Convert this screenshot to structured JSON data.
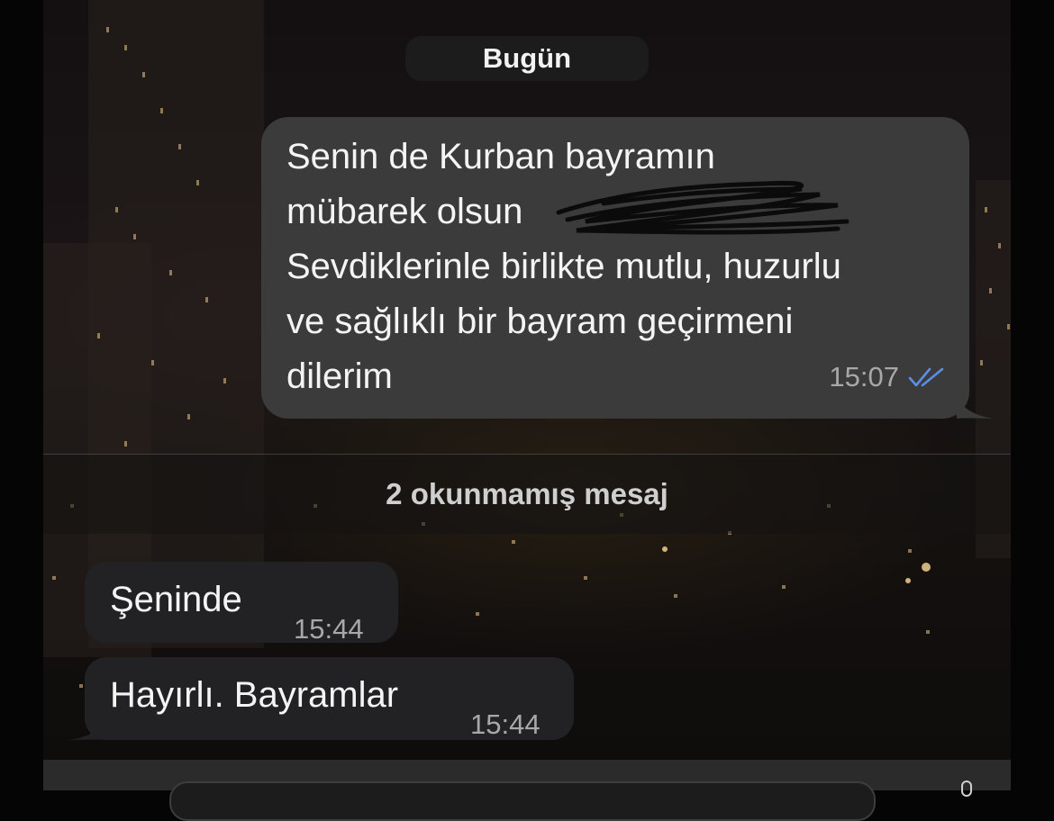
{
  "date_separator": "Bugün",
  "messages": [
    {
      "direction": "outgoing",
      "text": "Senin de Kurban bayramın\nmübarek olsun \nSevdiklerinle birlikte mutlu, huzurlu\nve sağlıklı bir bayram geçirmeni\ndilerim",
      "time": "15:07",
      "status": "read"
    },
    {
      "direction": "incoming",
      "text": "Şeninde",
      "time": "15:44"
    },
    {
      "direction": "incoming",
      "text": "Hayırlı. Bayramlar",
      "time": "15:44"
    }
  ],
  "unread_banner": "2 okunmamış mesaj",
  "colors": {
    "outgoing_bubble": "#3b3b3b",
    "incoming_bubble": "#222224",
    "read_ticks": "#5b8ee6"
  },
  "icons": {
    "read_receipt": "double-check-icon",
    "redaction": "scribble-redaction",
    "microphone": "mic-icon"
  }
}
